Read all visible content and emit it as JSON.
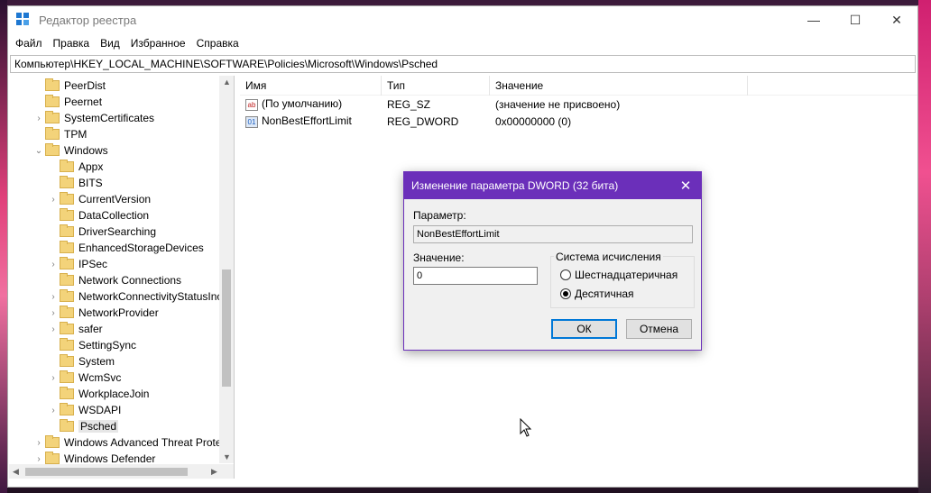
{
  "window": {
    "title": "Редактор реестра",
    "controls": {
      "minimize": "—",
      "maximize": "☐",
      "close": "✕"
    }
  },
  "menu": [
    "Файл",
    "Правка",
    "Вид",
    "Избранное",
    "Справка"
  ],
  "address": "Компьютер\\HKEY_LOCAL_MACHINE\\SOFTWARE\\Policies\\Microsoft\\Windows\\Psched",
  "tree": [
    {
      "label": "PeerDist",
      "arrow": "",
      "level": 1
    },
    {
      "label": "Peernet",
      "arrow": "",
      "level": 1
    },
    {
      "label": "SystemCertificates",
      "arrow": "›",
      "level": 1
    },
    {
      "label": "TPM",
      "arrow": "",
      "level": 1
    },
    {
      "label": "Windows",
      "arrow": "⌄",
      "level": 1
    },
    {
      "label": "Appx",
      "arrow": "",
      "level": 2
    },
    {
      "label": "BITS",
      "arrow": "",
      "level": 2
    },
    {
      "label": "CurrentVersion",
      "arrow": "›",
      "level": 2
    },
    {
      "label": "DataCollection",
      "arrow": "",
      "level": 2
    },
    {
      "label": "DriverSearching",
      "arrow": "",
      "level": 2
    },
    {
      "label": "EnhancedStorageDevices",
      "arrow": "",
      "level": 2
    },
    {
      "label": "IPSec",
      "arrow": "›",
      "level": 2
    },
    {
      "label": "Network Connections",
      "arrow": "",
      "level": 2
    },
    {
      "label": "NetworkConnectivityStatusInc",
      "arrow": "›",
      "level": 2
    },
    {
      "label": "NetworkProvider",
      "arrow": "›",
      "level": 2
    },
    {
      "label": "safer",
      "arrow": "›",
      "level": 2
    },
    {
      "label": "SettingSync",
      "arrow": "",
      "level": 2
    },
    {
      "label": "System",
      "arrow": "",
      "level": 2
    },
    {
      "label": "WcmSvc",
      "arrow": "›",
      "level": 2
    },
    {
      "label": "WorkplaceJoin",
      "arrow": "",
      "level": 2
    },
    {
      "label": "WSDAPI",
      "arrow": "›",
      "level": 2
    },
    {
      "label": "Psched",
      "arrow": "",
      "level": 2,
      "selected": true
    },
    {
      "label": "Windows Advanced Threat Prote",
      "arrow": "›",
      "level": 1
    },
    {
      "label": "Windows Defender",
      "arrow": "›",
      "level": 1
    }
  ],
  "list": {
    "columns": [
      "Имя",
      "Тип",
      "Значение"
    ],
    "rows": [
      {
        "icon": "ab",
        "name": "(По умолчанию)",
        "type": "REG_SZ",
        "value": "(значение не присвоено)"
      },
      {
        "icon": "01",
        "name": "NonBestEffortLimit",
        "type": "REG_DWORD",
        "value": "0x00000000 (0)"
      }
    ]
  },
  "dialog": {
    "title": "Изменение параметра DWORD (32 бита)",
    "param_label": "Параметр:",
    "param_value": "NonBestEffortLimit",
    "value_label": "Значение:",
    "value": "0",
    "base_group": "Система исчисления",
    "radio_hex": "Шестнадцатеричная",
    "radio_dec": "Десятичная",
    "ok": "ОК",
    "cancel": "Отмена",
    "close": "✕"
  },
  "colors": {
    "dialog_accent": "#6b2fba",
    "folder": "#f3d37a"
  }
}
